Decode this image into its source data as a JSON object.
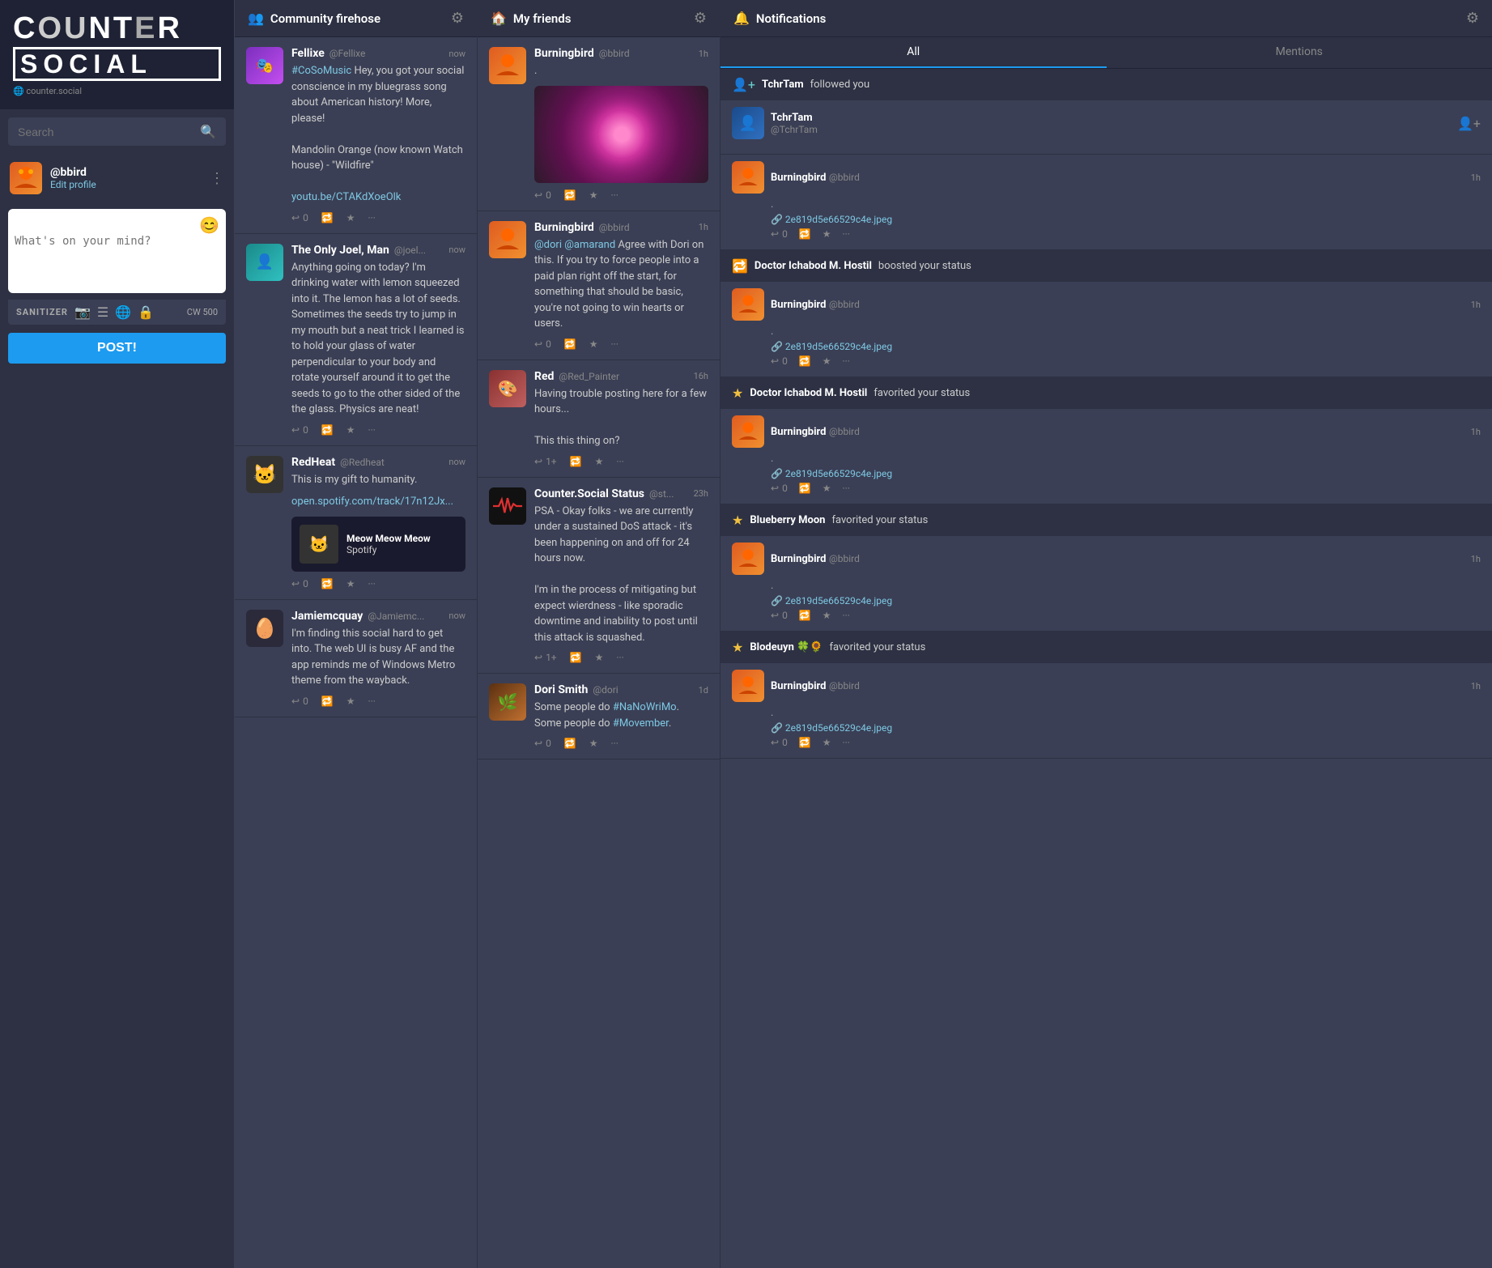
{
  "sidebar": {
    "logo_counter": "COUNTER",
    "logo_social": "SOCIAL",
    "search_placeholder": "Search",
    "profile": {
      "handle": "@bbird",
      "edit_label": "Edit profile"
    },
    "compose": {
      "placeholder": "What's on your mind?",
      "cw_label": "CW",
      "cw_count": "500",
      "sanitizer_label": "SANITIZER",
      "post_button": "POST!"
    }
  },
  "community_column": {
    "title": "Community firehose",
    "posts": [
      {
        "name": "Fellixe",
        "handle": "@Fellixe",
        "time": "now",
        "text": "#CoSoMusic Hey, you got your social conscience in my bluegrass song about American history! More, please!\n\nMandolin Orange (now known Watch house) - \"Wildfire\"\n\nyoutu.be/CTAKdXoeOlk",
        "avatar_style": "av-purple",
        "avatar_icon": "🎵",
        "replies": "0"
      },
      {
        "name": "The Only Joel, Man",
        "handle": "@joel...",
        "time": "now",
        "text": "Anything going on today? I'm drinking water with lemon squeezed into it. The lemon has a lot of seeds. Sometimes the seeds try to jump in my mouth but a neat trick I learned is to hold your glass of water perpendicular to your body and rotate yourself around it to get the seeds to go to the other sided of the the glass. Physics are neat!",
        "avatar_style": "av-teal",
        "avatar_icon": "👤",
        "replies": "0"
      },
      {
        "name": "RedHeat",
        "handle": "@Redheat",
        "time": "now",
        "text": "This is my gift to humanity.",
        "link": "open.spotify.com/track/17n12Jx...",
        "spotify_title": "Meow Meow Meow",
        "spotify_sub": "Spotify",
        "avatar_style": "av-gray",
        "avatar_icon": "🐱",
        "replies": "0"
      },
      {
        "name": "Jamiemcquay",
        "handle": "@Jamiemc...",
        "time": "now",
        "text": "I'm finding this social hard to get into. The web UI is busy AF and the app reminds me of Windows Metro theme from the wayback.",
        "avatar_style": "av-dark",
        "avatar_icon": "🥚",
        "replies": "0"
      }
    ]
  },
  "friends_column": {
    "title": "My friends",
    "posts": [
      {
        "name": "Burningbird",
        "handle": "@bbird",
        "time": "1h",
        "text": ".",
        "has_image": true,
        "avatar_style": "av-orange",
        "replies": "0"
      },
      {
        "name": "Burningbird",
        "handle": "@bbird",
        "time": "1h",
        "text": "@dori @amarand Agree with Dori on this. If you try to force people into a paid plan right off the start, for something that should be basic, you're not going to win hearts or users.",
        "avatar_style": "av-orange",
        "replies": "0"
      },
      {
        "name": "Red",
        "handle": "@Red_Painter",
        "time": "16h",
        "text": "Having trouble posting here for a few hours...\n\nThis this thing on?",
        "avatar_style": "av-red-av",
        "avatar_icon": "🎨",
        "replies": "1+"
      },
      {
        "name": "Counter.Social Status",
        "handle": "@st...",
        "time": "23h",
        "text": "PSA - Okay folks - we are currently under a sustained DoS attack - it's been happening on and off for 24 hours now.\n\nI'm in the process of mitigating but expect wierdness - like sporadic downtime and inability to post until this attack is squashed.",
        "avatar_style": "av-status",
        "replies": "1+"
      },
      {
        "name": "Dori Smith",
        "handle": "@dori",
        "time": "1d",
        "text": "Some people do #NaNoWriMo. Some people do #Movember.",
        "avatar_style": "av-green",
        "avatar_icon": "🌿",
        "replies": "0"
      }
    ]
  },
  "notifications": {
    "title": "Notifications",
    "tabs": [
      "All",
      "Mentions"
    ],
    "active_tab": "All",
    "items": [
      {
        "type": "follow",
        "actor": "TchrTam",
        "action": "followed you",
        "avatar_style": "av-blue",
        "avatar_icon": "👤",
        "post_author": "TchrTam",
        "post_handle": "@TchrTam",
        "post_time": "",
        "post_text": "",
        "post_file": "",
        "show_add_icon": true
      },
      {
        "type": "post-preview",
        "post_author": "Burningbird",
        "post_handle": "@bbird",
        "post_time": "1h",
        "post_text": ".",
        "post_file": "2e819d5e66529c4e.jpeg",
        "avatar_style": "av-orange",
        "avatar_icon": "🐦",
        "replies": "0"
      },
      {
        "type": "boost",
        "actor": "Doctor Ichabod M. Hostil",
        "action": "boosted your status",
        "avatar_style": "av-gray",
        "avatar_icon": "💀",
        "post_author": "Burningbird",
        "post_handle": "@bbird",
        "post_time": "1h",
        "post_text": ".",
        "post_file": "2e819d5e66529c4e.jpeg",
        "replies": "0"
      },
      {
        "type": "favorite",
        "actor": "Doctor Ichabod M. Hostil",
        "action": "favorited your status",
        "avatar_style": "av-gray",
        "avatar_icon": "💀",
        "post_author": "Burningbird",
        "post_handle": "@bbird",
        "post_time": "1h",
        "post_text": ".",
        "post_file": "2e819d5e66529c4e.jpeg",
        "replies": "0"
      },
      {
        "type": "favorite",
        "actor": "Blueberry Moon",
        "action": "favorited your status",
        "avatar_style": "av-blue",
        "avatar_icon": "🌙",
        "post_author": "Burningbird",
        "post_handle": "@bbird",
        "post_time": "1h",
        "post_text": ".",
        "post_file": "2e819d5e66529c4e.jpeg",
        "replies": "0"
      },
      {
        "type": "favorite",
        "actor": "Blodeuyn 🍀🌻",
        "action": "favorited your status",
        "avatar_style": "av-green",
        "avatar_icon": "🌸",
        "post_author": "Burningbird",
        "post_handle": "@bbird",
        "post_time": "1h",
        "post_text": ".",
        "post_file": "2e819d5e66529c4e.jpeg",
        "replies": "0"
      }
    ]
  },
  "icons": {
    "search": "🔍",
    "settings": "⚙",
    "reply": "↩",
    "boost": "🔁",
    "star": "★",
    "more": "•••",
    "follow": "👤+",
    "bell": "🔔",
    "home": "🏠",
    "people": "👥",
    "camera": "📷",
    "list": "☰",
    "globe": "🌐",
    "lock": "🔒",
    "emoji": "😊",
    "add_person": "👤+"
  }
}
